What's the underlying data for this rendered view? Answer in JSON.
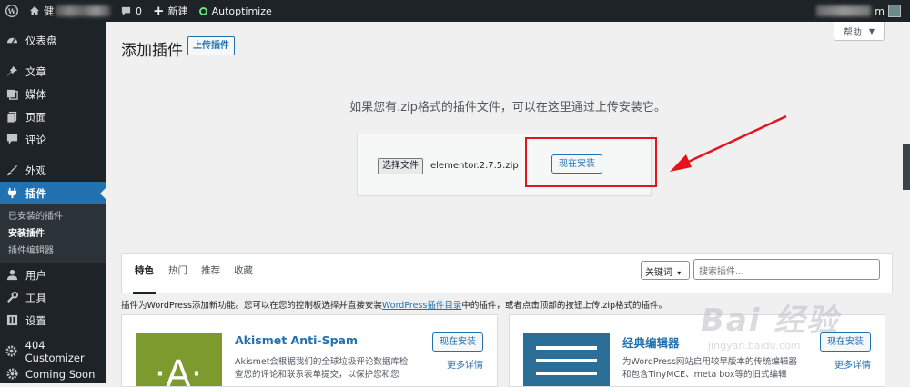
{
  "adminbar": {
    "site_name": "健",
    "comments_count": "0",
    "new_label": "新建",
    "autoptimize_label": "Autoptimize",
    "user_suffix": "m"
  },
  "sidebar": {
    "items": [
      {
        "label": "仪表盘",
        "icon": "dashboard-icon"
      },
      {
        "label": "文章",
        "icon": "pin-icon"
      },
      {
        "label": "媒体",
        "icon": "media-icon"
      },
      {
        "label": "页面",
        "icon": "page-icon"
      },
      {
        "label": "评论",
        "icon": "comment-icon"
      },
      {
        "label": "外观",
        "icon": "brush-icon"
      },
      {
        "label": "插件",
        "icon": "plugin-icon"
      },
      {
        "label": "用户",
        "icon": "user-icon"
      },
      {
        "label": "工具",
        "icon": "wrench-icon"
      },
      {
        "label": "设置",
        "icon": "settings-icon"
      },
      {
        "label": "404 Customizer",
        "icon": "gear-icon"
      },
      {
        "label": "Coming Soon",
        "icon": "gear-icon"
      }
    ],
    "submenu": [
      "已安装的插件",
      "安装插件",
      "插件编辑器"
    ]
  },
  "header": {
    "title": "添加插件",
    "upload_button": "上传插件",
    "help_label": "帮助"
  },
  "upload": {
    "description": "如果您有.zip格式的插件文件，可以在这里通过上传安装它。",
    "choose_file": "选择文件",
    "file_name": "elementor.2.7.5.zip",
    "install_now": "现在安装"
  },
  "filter": {
    "tabs": [
      "特色",
      "热门",
      "推荐",
      "收藏"
    ],
    "keyword_select": "关键词",
    "search_placeholder": "搜索插件..."
  },
  "intro": {
    "before": "插件为WordPress添加新功能。您可以在您的控制板选择并直接安装",
    "link": "WordPress插件目录",
    "after": "中的插件，或者点击顶部的按钮上传.zip格式的插件。"
  },
  "cards": [
    {
      "name": "Akismet Anti-Spam",
      "description": "Akismet会根据我们的全球垃圾评论数据库检查您的评论和联系表单提交，以保护您和您",
      "install": "现在安装",
      "more": "更多详情",
      "color": "#7c9a2e"
    },
    {
      "name": "经典编辑器",
      "description": "为WordPress网站启用较早版本的传统编辑器和包含TinyMCE、meta box等的旧式编辑",
      "install": "现在安装",
      "more": "更多详情",
      "color": "#2b6e98"
    }
  ],
  "watermark": {
    "title": "Bai 经验",
    "url": "jingyan.baidu.com"
  }
}
